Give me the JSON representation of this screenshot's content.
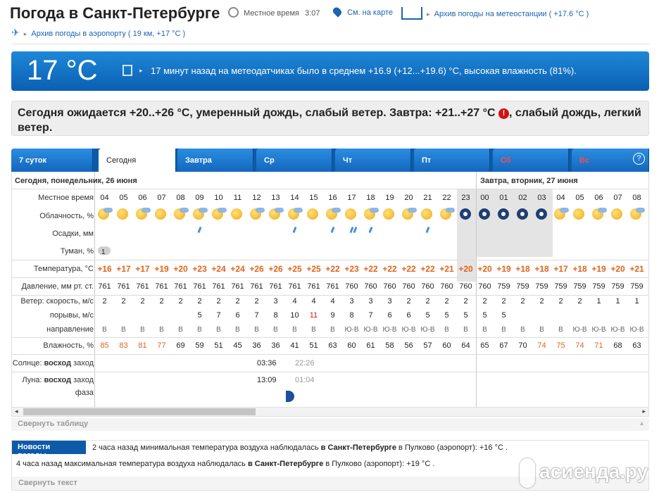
{
  "header": {
    "title": "Погода в Санкт-Петербурге",
    "local_time_label": "Местное время",
    "local_time_value": "3:07",
    "map_link": "См. на карте",
    "station_link": "Архив погоды на метеостанции ( +17.6 °C )",
    "airport_link": "Архив погоды в аэропорту ( 19 км, +17 °C )"
  },
  "now": {
    "temp": "17 °C",
    "desc": "17 минут назад на метеодатчиках было в среднем +16.9 (+12...+19.6) °C, высокая влажность (81%)."
  },
  "forecast": {
    "text1": "Сегодня ожидается +20..+26 °C, умеренный дождь, слабый ветер. Завтра: +21..+27 °C",
    "warn": "!",
    "text2": ", слабый дождь, легкий ветер."
  },
  "tabs": [
    {
      "label": "7 суток"
    },
    {
      "label": "Сегодня"
    },
    {
      "label": "Завтра"
    },
    {
      "label": "Ср"
    },
    {
      "label": "Чт"
    },
    {
      "label": "Пт"
    },
    {
      "label": "Сб"
    },
    {
      "label": "Вс"
    }
  ],
  "help": "?",
  "table": {
    "today_header": "Сегодня, понедельник, 26 июня",
    "tomorrow_header": "Завтра, вторник, 27 июня",
    "labels": {
      "time": "Местное время",
      "clouds": "Облачность, %",
      "precip": "Осадки, мм",
      "fog": "Туман, %",
      "temp": "Температура, °C",
      "pressure": "Давление, мм рт. ст.",
      "wind_speed": "Ветер: скорость, м/с",
      "gusts": "порывы, м/с",
      "direction": "направление",
      "humidity": "Влажность, %",
      "sun_prefix": "Солнце:",
      "sun_rise": "восход",
      "sun_set": "заход",
      "moon_prefix": "Луна:",
      "moon_rise": "восход",
      "moon_set": "заход",
      "phase": "фаза"
    },
    "hours": [
      "04",
      "05",
      "06",
      "07",
      "08",
      "09",
      "10",
      "11",
      "12",
      "13",
      "14",
      "15",
      "16",
      "17",
      "18",
      "19",
      "20",
      "21",
      "22",
      "23",
      "00",
      "01",
      "02",
      "03",
      "04",
      "05",
      "06",
      "07",
      "08"
    ],
    "fog_value": "1",
    "temps": [
      "+16",
      "+17",
      "+17",
      "+19",
      "+20",
      "+23",
      "+24",
      "+24",
      "+26",
      "+26",
      "+25",
      "+25",
      "+22",
      "+23",
      "+22",
      "+22",
      "+22",
      "+22",
      "+21",
      "+20",
      "+20",
      "+19",
      "+18",
      "+18",
      "+17",
      "+18",
      "+19",
      "+20",
      "+21"
    ],
    "pressure": [
      "761",
      "761",
      "761",
      "761",
      "761",
      "761",
      "761",
      "761",
      "761",
      "761",
      "761",
      "761",
      "761",
      "760",
      "760",
      "760",
      "760",
      "760",
      "760",
      "760",
      "760",
      "759",
      "759",
      "759",
      "759",
      "759",
      "759",
      "759",
      "759"
    ],
    "wind": [
      "2",
      "2",
      "2",
      "2",
      "2",
      "2",
      "2",
      "2",
      "2",
      "3",
      "4",
      "4",
      "4",
      "3",
      "3",
      "3",
      "2",
      "2",
      "2",
      "2",
      "2",
      "2",
      "2",
      "2",
      "2",
      "2",
      "1",
      "1",
      "1"
    ],
    "gusts": [
      "",
      "",
      "",
      "",
      "",
      "5",
      "7",
      "6",
      "7",
      "8",
      "10",
      "11",
      "9",
      "8",
      "7",
      "6",
      "6",
      "5",
      "5",
      "5",
      "5",
      "5",
      "",
      "",
      "",
      "",
      "",
      "",
      ""
    ],
    "dirs": [
      "В",
      "В",
      "В",
      "В",
      "В",
      "В",
      "В",
      "В",
      "В",
      "В",
      "В",
      "В",
      "В",
      "Ю-В",
      "Ю-В",
      "Ю-В",
      "Ю-В",
      "Ю-В",
      "В",
      "В",
      "В",
      "В",
      "В",
      "В",
      "В",
      "Ю-В",
      "Ю-В",
      "Ю-В",
      "Ю-В"
    ],
    "humidity": [
      "85",
      "83",
      "81",
      "77",
      "69",
      "59",
      "51",
      "45",
      "36",
      "36",
      "41",
      "51",
      "63",
      "60",
      "61",
      "58",
      "56",
      "57",
      "60",
      "64",
      "65",
      "67",
      "70",
      "74",
      "75",
      "74",
      "71",
      "68",
      "63"
    ],
    "sunrise": "03:36",
    "sunset": "22:26",
    "moonrise": "13:09",
    "moonset": "01:04"
  },
  "collapse_table": "Свернуть таблицу",
  "news": {
    "title": "Новости погоды",
    "item1_a": "2 часа назад минимальная температура воздуха наблюдалась ",
    "item1_b": "в Санкт-Петербурге",
    "item1_c": " в Пулково (аэропорт): +16 °C .",
    "item2_a": "4 часа назад максимальная температура воздуха наблюдалась ",
    "item2_b": "в Санкт-Петербурге",
    "item2_c": " в Пулково (аэропорт): +19 °C .",
    "collapse": "Свернуть текст"
  },
  "watermark": "асиенда.ру",
  "colors": {
    "accent": "#0d5ba8",
    "warm_value": "#e2641b",
    "red_value": "#e0190f",
    "weekend": "#ff4a4a"
  }
}
